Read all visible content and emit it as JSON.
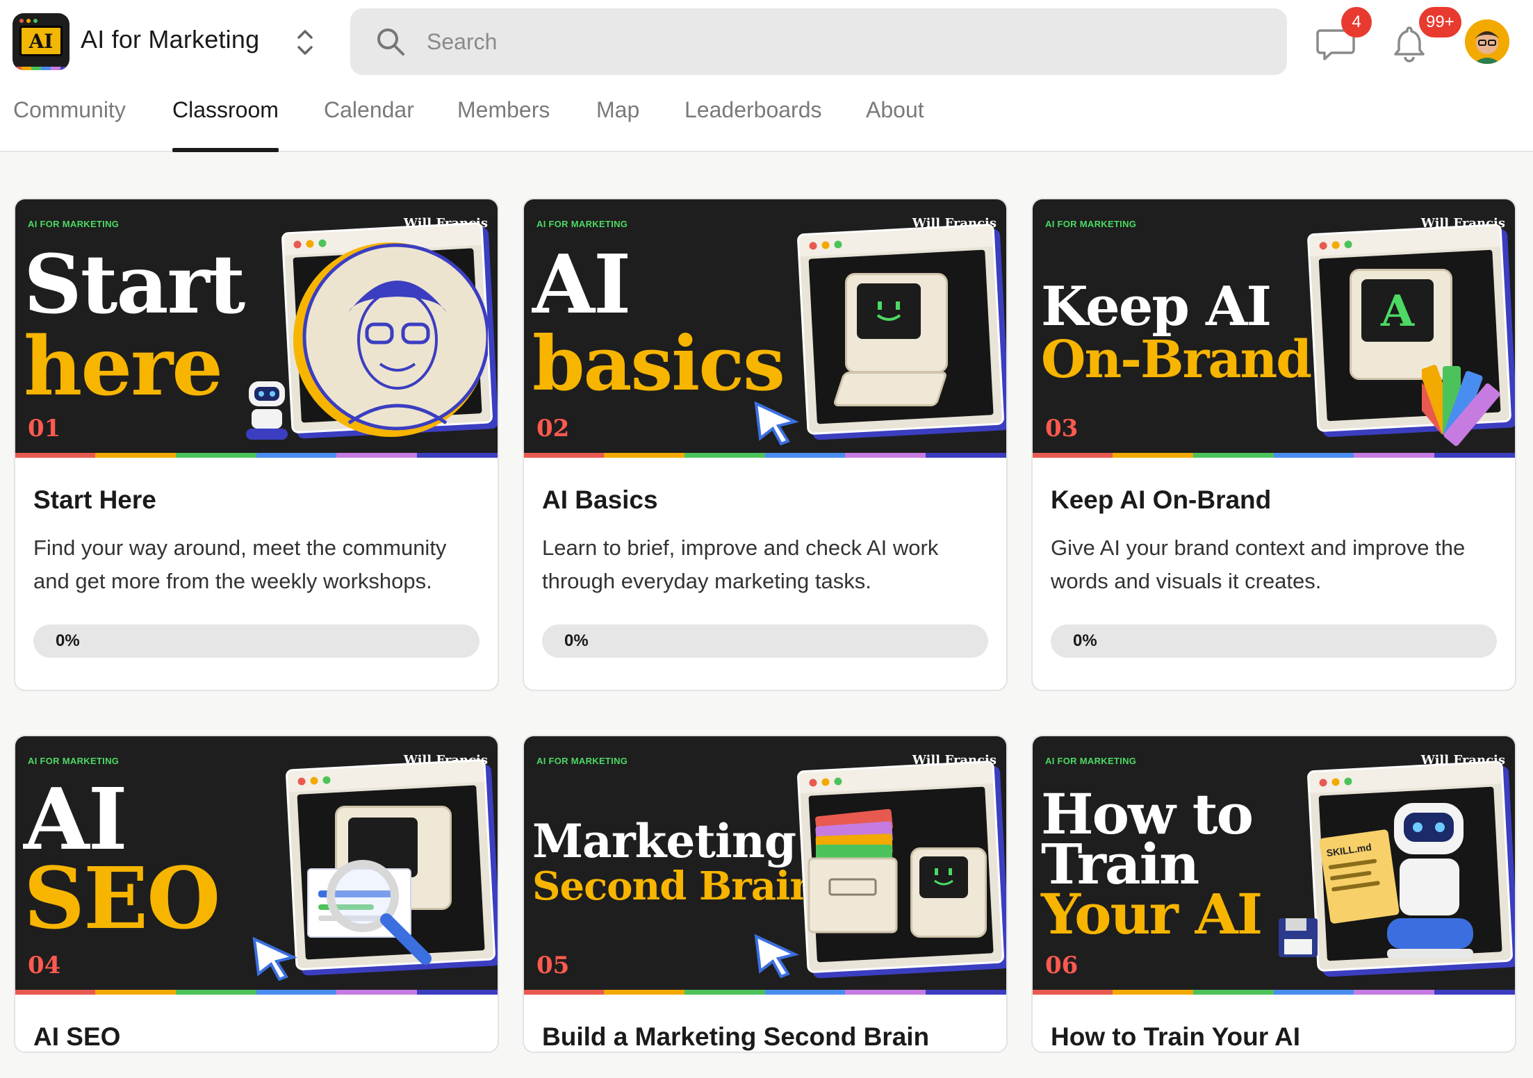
{
  "header": {
    "app_title": "AI for Marketing",
    "logo_text": "AI",
    "search_placeholder": "Search",
    "chat_badge": "4",
    "notifications_badge": "99+"
  },
  "tabs": [
    {
      "label": "Community",
      "active": false
    },
    {
      "label": "Classroom",
      "active": true
    },
    {
      "label": "Calendar",
      "active": false
    },
    {
      "label": "Members",
      "active": false
    },
    {
      "label": "Map",
      "active": false
    },
    {
      "label": "Leaderboards",
      "active": false
    },
    {
      "label": "About",
      "active": false
    }
  ],
  "courses": [
    {
      "thumb_tag": "AI FOR MARKETING",
      "thumb_author": "Will Francis",
      "thumb_line1": "Start",
      "thumb_line2": "here",
      "thumb_number": "01",
      "title": "Start Here",
      "description": "Find your way around, meet the community and get more from the weekly workshops.",
      "progress": 0,
      "progress_label": "0%"
    },
    {
      "thumb_tag": "AI FOR MARKETING",
      "thumb_author": "Will Francis",
      "thumb_line1": "AI",
      "thumb_line2": "basics",
      "thumb_number": "02",
      "title": "AI Basics",
      "description": "Learn to brief, improve and check AI work through everyday marketing tasks.",
      "progress": 0,
      "progress_label": "0%"
    },
    {
      "thumb_tag": "AI FOR MARKETING",
      "thumb_author": "Will Francis",
      "thumb_line1": "Keep AI",
      "thumb_line2": "On-Brand",
      "thumb_screen": "A",
      "thumb_number": "03",
      "title": "Keep AI On-Brand",
      "description": "Give AI your brand context and improve the words and visuals it creates.",
      "progress": 0,
      "progress_label": "0%"
    },
    {
      "thumb_tag": "AI FOR MARKETING",
      "thumb_author": "Will Francis",
      "thumb_line1": "AI",
      "thumb_line2": "SEO",
      "thumb_number": "04",
      "title": "AI SEO"
    },
    {
      "thumb_tag": "AI FOR MARKETING",
      "thumb_author": "Will Francis",
      "thumb_line1": "Marketing",
      "thumb_line2": "Second Brain",
      "thumb_number": "05",
      "title": "Build a Marketing Second Brain"
    },
    {
      "thumb_tag": "AI FOR MARKETING",
      "thumb_author": "Will Francis",
      "thumb_line1": "How to",
      "thumb_line1b": "Train",
      "thumb_line2": "Your AI",
      "thumb_paper": "SKILL.md",
      "thumb_number": "06",
      "title": "How to Train Your AI"
    }
  ],
  "colors": {
    "accent_yellow": "#f7b500",
    "number_red": "#ff5a4f",
    "tag_green": "#4cd964",
    "badge_red": "#e83a2f"
  }
}
